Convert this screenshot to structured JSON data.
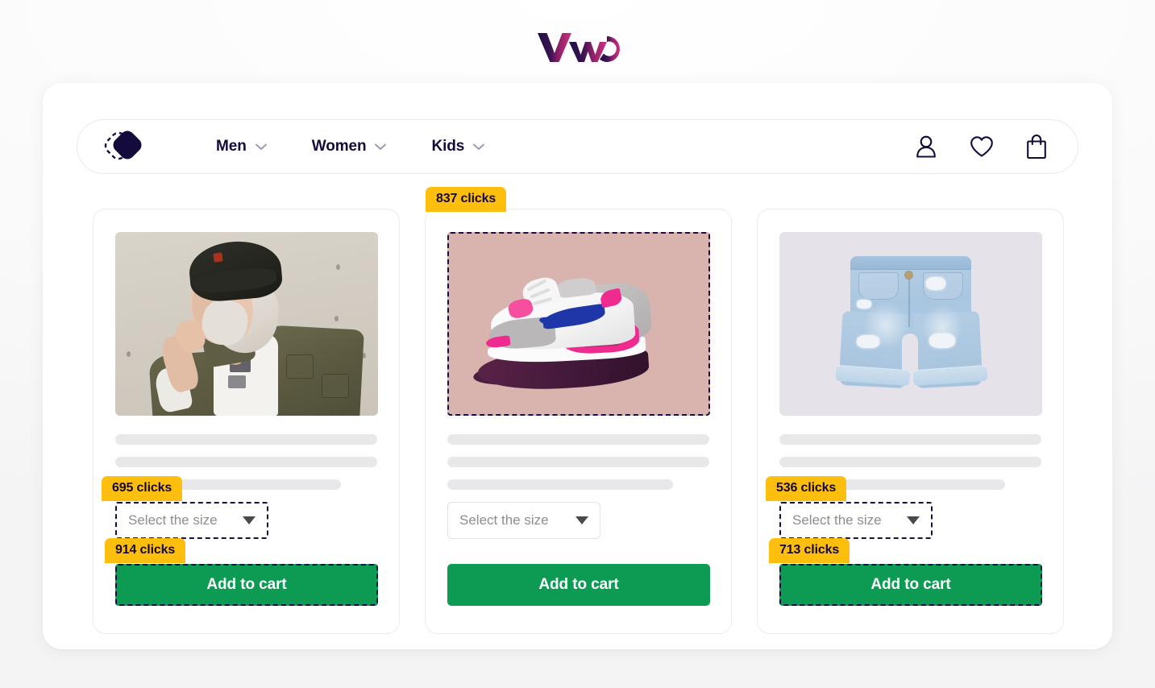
{
  "brand": {
    "logo_text": "VWO",
    "logo_name": "vwo-logo",
    "gradient_start": "#1d1145",
    "gradient_end": "#d1307f"
  },
  "theme": {
    "navy": "#140a3c",
    "badge_bg": "#fdbe0d",
    "cta_green": "#0d9b53",
    "page_bg": "#fbfbfb",
    "card_border": "#ececef"
  },
  "navbar": {
    "store_logo_name": "store-diamond-logo",
    "links": [
      {
        "label": "Men",
        "icon": "chevron-down-icon"
      },
      {
        "label": "Women",
        "icon": "chevron-down-icon"
      },
      {
        "label": "Kids",
        "icon": "chevron-down-icon"
      }
    ],
    "icons": [
      {
        "name": "account-icon",
        "label": "Account"
      },
      {
        "name": "wishlist-icon",
        "label": "Wishlist"
      },
      {
        "name": "cart-icon",
        "label": "Cart"
      }
    ]
  },
  "products": [
    {
      "image_name": "product-image-woman-jacket",
      "image_alt": "Woman in black beanie and olive jacket",
      "image_bg": "#d2ccc2",
      "image_tracked": false,
      "image_badge": null,
      "select": {
        "placeholder": "Select the size",
        "value": "",
        "tracked": true,
        "badge": "695 clicks"
      },
      "cta": {
        "label": "Add to cart",
        "tracked": true,
        "badge": "914 clicks"
      }
    },
    {
      "image_name": "product-image-sneaker",
      "image_alt": "Pink and white running sneaker",
      "image_bg": "#d9b3ae",
      "image_tracked": true,
      "image_badge": "837 clicks",
      "select": {
        "placeholder": "Select the size",
        "value": "",
        "tracked": false,
        "badge": null
      },
      "cta": {
        "label": "Add to cart",
        "tracked": false,
        "badge": null
      }
    },
    {
      "image_name": "product-image-denim-shorts",
      "image_alt": "Light blue distressed denim shorts",
      "image_bg": "#e5e2ea",
      "image_tracked": false,
      "image_badge": null,
      "select": {
        "placeholder": "Select the size",
        "value": "",
        "tracked": true,
        "badge": "536 clicks"
      },
      "cta": {
        "label": "Add to cart",
        "tracked": true,
        "badge": "713 clicks"
      }
    }
  ],
  "click_summary": {
    "sneaker_image": "837 clicks",
    "card1_select": "695 clicks",
    "card1_cta": "914 clicks",
    "card3_select": "536 clicks",
    "card3_cta": "713 clicks"
  }
}
